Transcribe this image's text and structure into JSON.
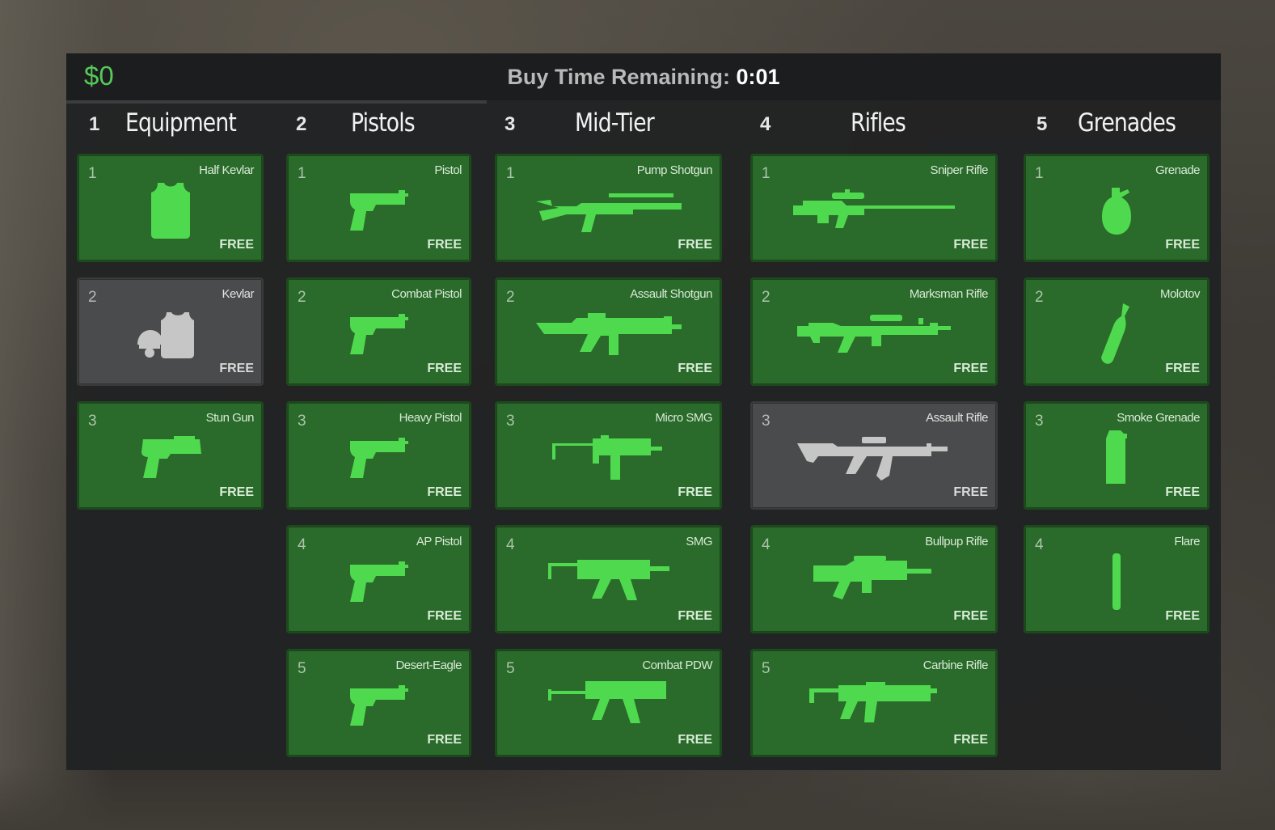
{
  "header": {
    "money": "$0",
    "buy_time_label": "Buy Time Remaining:",
    "buy_time_value": "0:01"
  },
  "colors": {
    "accent": "#4fd94f",
    "card_bg": "#2a6a2a",
    "card_disabled_bg": "#4a4b4c",
    "money": "#56c95a"
  },
  "columns": [
    {
      "number": "1",
      "title": "Equipment",
      "items": [
        {
          "slot": "1",
          "name": "Half Kevlar",
          "price": "FREE",
          "icon": "vest-icon",
          "disabled": false
        },
        {
          "slot": "2",
          "name": "Kevlar",
          "price": "FREE",
          "icon": "helmet-vest-icon",
          "disabled": true
        },
        {
          "slot": "3",
          "name": "Stun Gun",
          "price": "FREE",
          "icon": "stun-gun-icon",
          "disabled": false
        }
      ]
    },
    {
      "number": "2",
      "title": "Pistols",
      "items": [
        {
          "slot": "1",
          "name": "Pistol",
          "price": "FREE",
          "icon": "pistol-icon",
          "disabled": false
        },
        {
          "slot": "2",
          "name": "Combat Pistol",
          "price": "FREE",
          "icon": "pistol-icon",
          "disabled": false
        },
        {
          "slot": "3",
          "name": "Heavy Pistol",
          "price": "FREE",
          "icon": "pistol-icon",
          "disabled": false
        },
        {
          "slot": "4",
          "name": "AP Pistol",
          "price": "FREE",
          "icon": "pistol-icon",
          "disabled": false
        },
        {
          "slot": "5",
          "name": "Desert-Eagle",
          "price": "FREE",
          "icon": "pistol-icon",
          "disabled": false
        }
      ]
    },
    {
      "number": "3",
      "title": "Mid-Tier",
      "items": [
        {
          "slot": "1",
          "name": "Pump Shotgun",
          "price": "FREE",
          "icon": "shotgun-icon",
          "disabled": false
        },
        {
          "slot": "2",
          "name": "Assault Shotgun",
          "price": "FREE",
          "icon": "assault-shotgun-icon",
          "disabled": false
        },
        {
          "slot": "3",
          "name": "Micro SMG",
          "price": "FREE",
          "icon": "micro-smg-icon",
          "disabled": false
        },
        {
          "slot": "4",
          "name": "SMG",
          "price": "FREE",
          "icon": "smg-icon",
          "disabled": false
        },
        {
          "slot": "5",
          "name": "Combat PDW",
          "price": "FREE",
          "icon": "pdw-icon",
          "disabled": false
        }
      ]
    },
    {
      "number": "4",
      "title": "Rifles",
      "items": [
        {
          "slot": "1",
          "name": "Sniper Rifle",
          "price": "FREE",
          "icon": "sniper-rifle-icon",
          "disabled": false
        },
        {
          "slot": "2",
          "name": "Marksman Rifle",
          "price": "FREE",
          "icon": "marksman-rifle-icon",
          "disabled": false
        },
        {
          "slot": "3",
          "name": "Assault Rifle",
          "price": "FREE",
          "icon": "assault-rifle-icon",
          "disabled": true
        },
        {
          "slot": "4",
          "name": "Bullpup Rifle",
          "price": "FREE",
          "icon": "bullpup-rifle-icon",
          "disabled": false
        },
        {
          "slot": "5",
          "name": "Carbine Rifle",
          "price": "FREE",
          "icon": "carbine-rifle-icon",
          "disabled": false
        }
      ]
    },
    {
      "number": "5",
      "title": "Grenades",
      "items": [
        {
          "slot": "1",
          "name": "Grenade",
          "price": "FREE",
          "icon": "grenade-icon",
          "disabled": false
        },
        {
          "slot": "2",
          "name": "Molotov",
          "price": "FREE",
          "icon": "molotov-icon",
          "disabled": false
        },
        {
          "slot": "3",
          "name": "Smoke Grenade",
          "price": "FREE",
          "icon": "smoke-grenade-icon",
          "disabled": false
        },
        {
          "slot": "4",
          "name": "Flare",
          "price": "FREE",
          "icon": "flare-icon",
          "disabled": false
        }
      ]
    }
  ]
}
